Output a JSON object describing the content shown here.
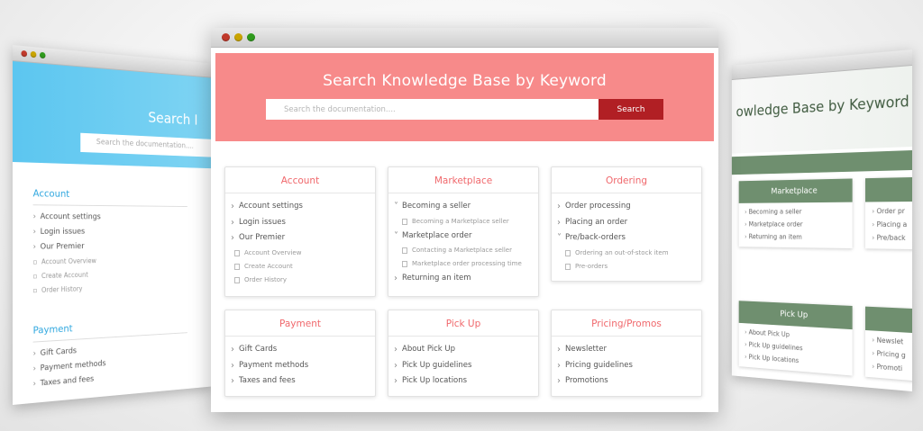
{
  "left_window": {
    "title_partial": "Search I",
    "search_placeholder": "Search the documentation....",
    "account": {
      "heading": "Account",
      "items": [
        "Account settings",
        "Login issues",
        "Our Premier"
      ],
      "subitems": [
        "Account Overview",
        "Create Account",
        "Order History"
      ]
    },
    "payment": {
      "heading": "Payment",
      "items": [
        "Gift Cards",
        "Payment methods",
        "Taxes and fees"
      ]
    }
  },
  "right_window": {
    "title_partial": "owledge Base by Keyword",
    "marketplace": {
      "heading": "Marketplace",
      "items": [
        "Becoming a seller",
        "Marketplace order",
        "Returning an item"
      ]
    },
    "pickup": {
      "heading": "Pick Up",
      "items": [
        "About Pick Up",
        "Pick Up guidelines",
        "Pick Up locations"
      ]
    },
    "partial_a": [
      "Order pr",
      "Placing a",
      "Pre/back"
    ],
    "partial_b": [
      "Newslet",
      "Pricing g",
      "Promoti"
    ]
  },
  "main": {
    "hero_title": "Search Knowledge Base by Keyword",
    "search_placeholder": "Search the documentation....",
    "search_button": "Search",
    "colors": {
      "hero": "#f78a8a",
      "button": "#b11f24",
      "accent": "#f0686c"
    },
    "cards": {
      "account": {
        "title": "Account",
        "items": [
          "Account settings",
          "Login issues",
          "Our Premier"
        ],
        "subitems": [
          "Account Overview",
          "Create Account",
          "Order History"
        ]
      },
      "marketplace": {
        "title": "Marketplace",
        "item1": "Becoming a seller",
        "sub1": "Becoming a Marketplace seller",
        "item2": "Marketplace order",
        "sub2a": "Contacting a Marketplace seller",
        "sub2b": "Marketplace order processing time",
        "item3": "Returning an item"
      },
      "ordering": {
        "title": "Ordering",
        "items": [
          "Order processing",
          "Placing an order"
        ],
        "item3": "Pre/back-orders",
        "subitems": [
          "Ordering an out-of-stock item",
          "Pre-orders"
        ]
      },
      "payment": {
        "title": "Payment",
        "items": [
          "Gift Cards",
          "Payment methods",
          "Taxes and fees"
        ]
      },
      "pickup": {
        "title": "Pick Up",
        "items": [
          "About Pick Up",
          "Pick Up guidelines",
          "Pick Up locations"
        ]
      },
      "pricing": {
        "title": "Pricing/Promos",
        "items": [
          "Newsletter",
          "Pricing guidelines",
          "Promotions"
        ]
      }
    }
  }
}
